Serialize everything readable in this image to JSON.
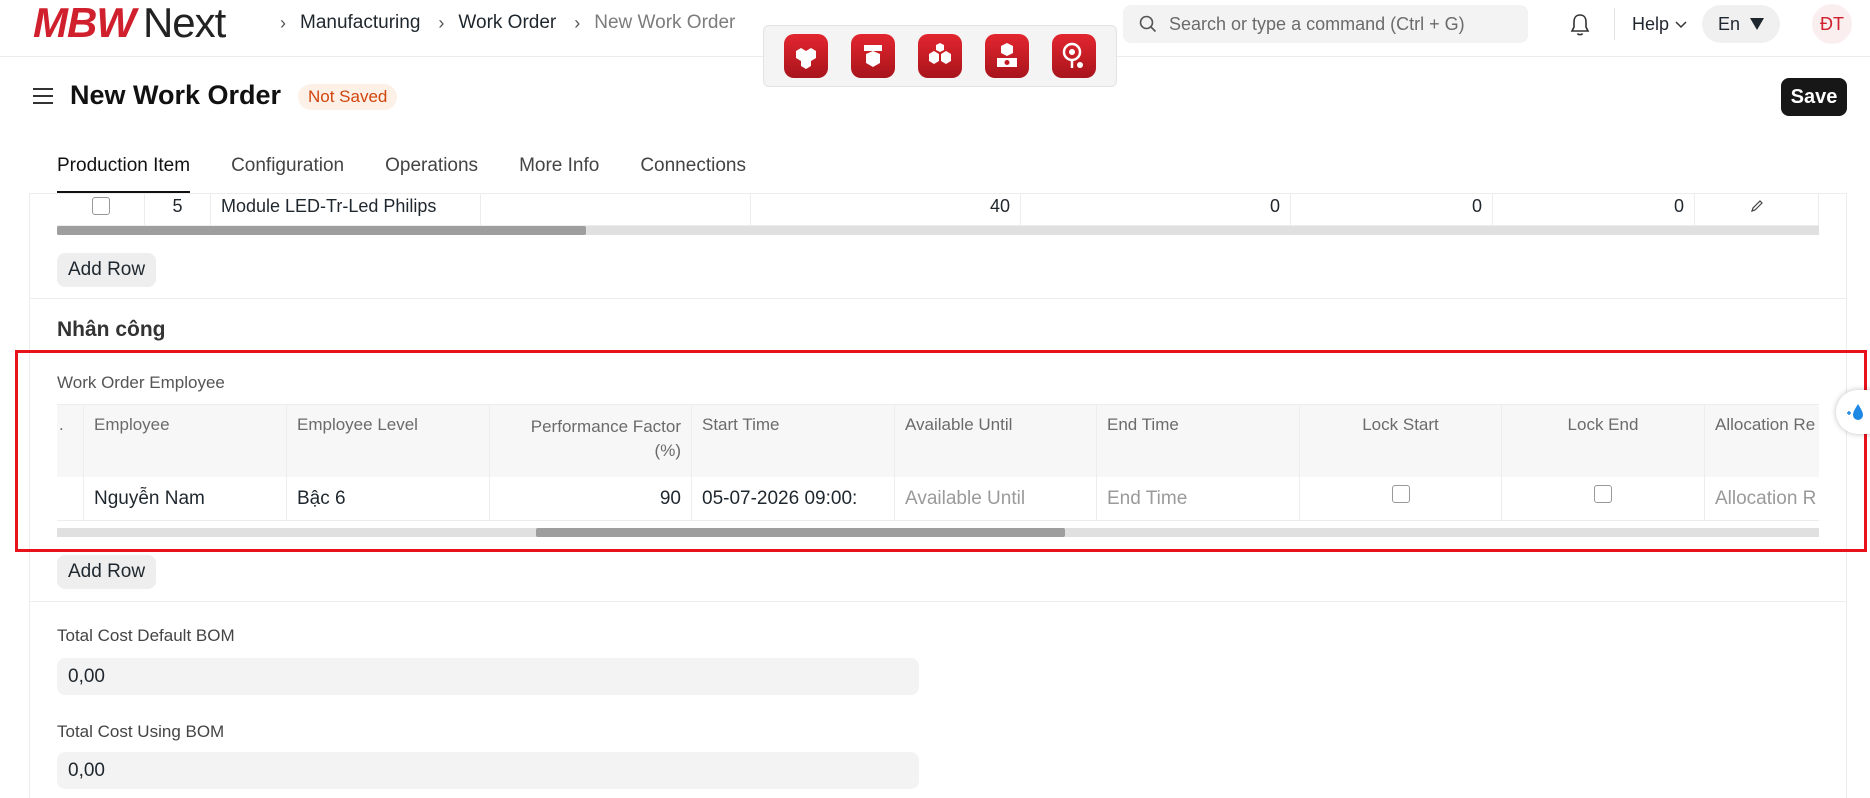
{
  "brand": {
    "logo_mbw": "MBW",
    "logo_next": "Next"
  },
  "breadcrumbs": [
    "Manufacturing",
    "Work Order",
    "New Work Order"
  ],
  "search": {
    "placeholder": "Search or type a command (Ctrl + G)"
  },
  "nav": {
    "help_label": "Help",
    "language": "En",
    "avatar_initials": "ĐT"
  },
  "page": {
    "title": "New Work Order",
    "status": "Not Saved",
    "save_label": "Save"
  },
  "tabs": [
    "Production Item",
    "Configuration",
    "Operations",
    "More Info",
    "Connections"
  ],
  "items_row": {
    "index": "5",
    "item_name": "Module LED-Tr-Led Philips",
    "qty": "40",
    "v1": "0",
    "v2": "0",
    "v3": "0"
  },
  "add_row_label": "Add Row",
  "labour_section": {
    "title": "Nhân công",
    "table_label": "Work Order Employee"
  },
  "employee_table": {
    "headers": [
      "Employee",
      "Employee Level",
      "Performance Factor (%)",
      "Start Time",
      "Available Until",
      "End Time",
      "Lock Start",
      "Lock End",
      "Allocation Re"
    ],
    "row": {
      "employee": "Nguyễn Nam",
      "level": "Bậc 6",
      "performance": "90",
      "start_time": "05-07-2026 09:00:",
      "available_until_placeholder": "Available Until",
      "end_time_placeholder": "End Time",
      "allocation_placeholder": "Allocation R"
    }
  },
  "totals": {
    "default_bom_label": "Total Cost Default BOM",
    "default_bom_value": "0,00",
    "using_bom_label": "Total Cost Using BOM",
    "using_bom_value": "0,00"
  },
  "colors": {
    "brand_red": "#d0202d",
    "highlight": "#e8121b",
    "status_text": "#d1450e"
  }
}
